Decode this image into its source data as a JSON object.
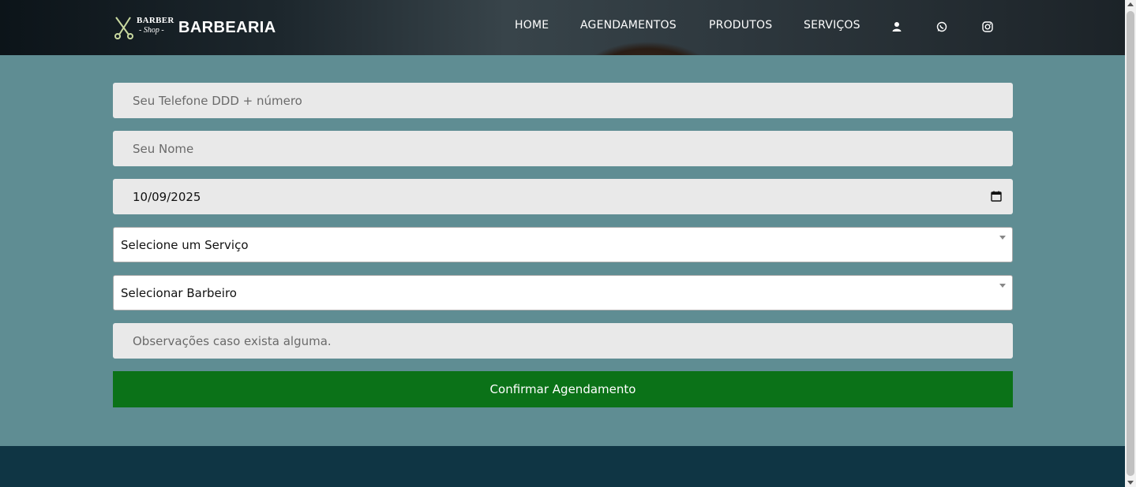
{
  "header": {
    "logo_line1": "BARBER",
    "logo_line2": "- Shop -",
    "brand": "BARBEARIA",
    "nav": [
      "HOME",
      "AGENDAMENTOS",
      "PRODUTOS",
      "SERVIÇOS"
    ],
    "icons": [
      "user-icon",
      "whatsapp-icon",
      "instagram-icon"
    ]
  },
  "form": {
    "phone_placeholder": "Seu Telefone DDD + número",
    "name_placeholder": "Seu Nome",
    "date_value": "10/09/2025",
    "service_selected": "Selecione um Serviço",
    "barber_selected": "Selecionar Barbeiro",
    "notes_placeholder": "Observações caso exista alguma.",
    "submit_label": "Confirmar Agendamento"
  },
  "colors": {
    "background": "#5f8d93",
    "button": "#0b7218",
    "footer": "#0f3544",
    "input": "#e9e9e9"
  }
}
